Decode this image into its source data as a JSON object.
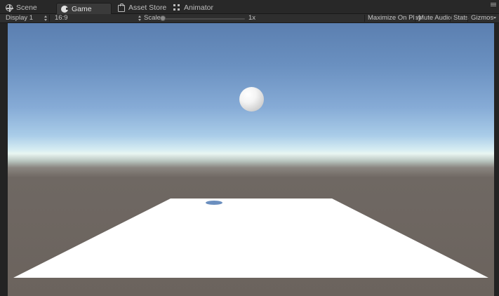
{
  "tabs": [
    {
      "label": "Scene",
      "icon": "scene-icon"
    },
    {
      "label": "Game",
      "icon": "game-icon",
      "active": true
    },
    {
      "label": "Asset Store",
      "icon": "asset-store-icon"
    },
    {
      "label": "Animator",
      "icon": "animator-icon"
    }
  ],
  "toolbar": {
    "display": "Display 1",
    "aspect": "16:9",
    "scale_label": "Scale",
    "scale_value": "1x",
    "scale_level": 0,
    "maximize_on_play": "Maximize On Play",
    "mute_audio": "Mute Audio",
    "stats": "Stats",
    "gizmos": "Gizmos"
  },
  "colors": {
    "sky_top": "#5b7fb0",
    "horizon": "#e9f6f2",
    "ground": "#6b635d",
    "plane": "#ffffff",
    "shadow": "#6b8fbf"
  }
}
